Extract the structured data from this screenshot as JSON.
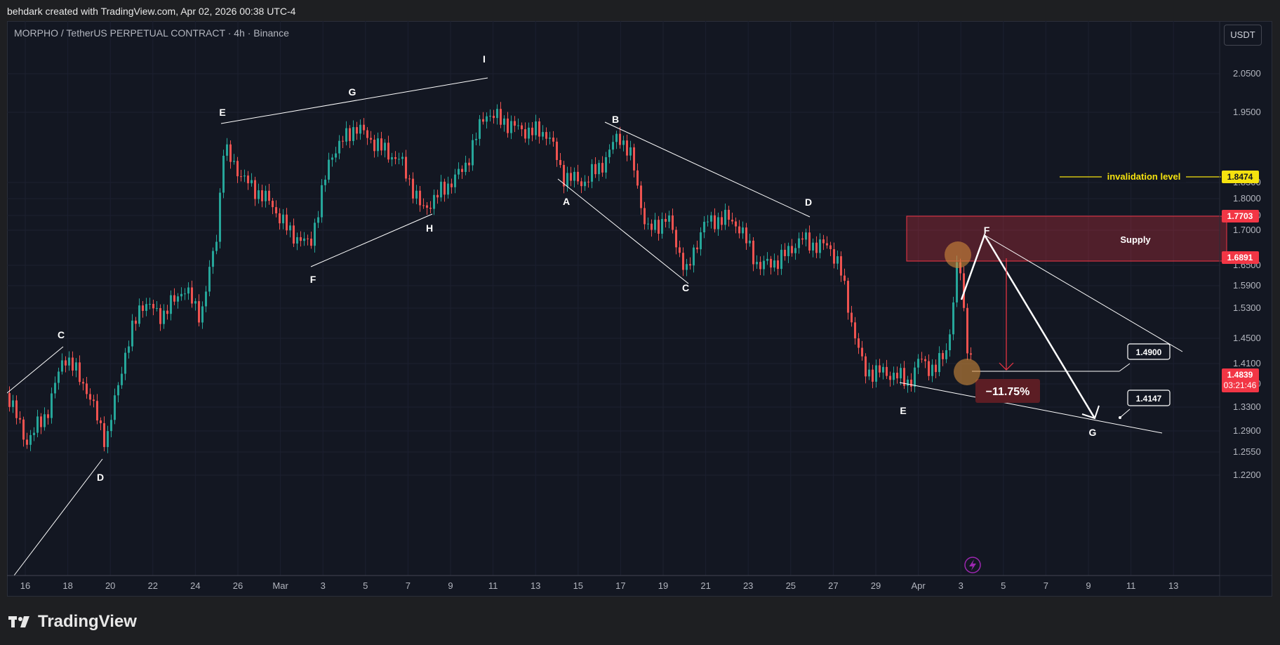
{
  "header": {
    "credit": "behdark created with TradingView.com, Apr 02, 2026 00:38 UTC-4"
  },
  "chart_header": {
    "symbol": "MORPHO / TetherUS PERPETUAL CONTRACT · 4h · Binance",
    "currency": "USDT"
  },
  "footer": {
    "brand": "TradingView"
  },
  "colors": {
    "background": "#131722",
    "up": "#26a69a",
    "down": "#ef5350",
    "supply_zone": "#f23645",
    "invalidation": "#f5e20f",
    "highlight": "#d08a3a"
  },
  "chart_data": {
    "type": "candlestick",
    "y_ticks": [
      "2.0500",
      "1.9500",
      "1.8500",
      "1.8000",
      "1.7500",
      "1.7000",
      "1.6500",
      "1.5900",
      "1.5300",
      "1.4500",
      "1.4100",
      "1.3700",
      "1.3300",
      "1.2900",
      "1.2550",
      "1.2200"
    ],
    "x_ticks": [
      "16",
      "18",
      "20",
      "22",
      "24",
      "26",
      "Mar",
      "3",
      "5",
      "7",
      "9",
      "11",
      "13",
      "15",
      "17",
      "19",
      "21",
      "23",
      "25",
      "27",
      "29",
      "Apr",
      "3",
      "5",
      "7",
      "9",
      "11",
      "13"
    ],
    "price_labels": [
      {
        "value": "1.8474",
        "color": "#f5e20f",
        "text_color": "#131722"
      },
      {
        "value": "1.7703",
        "color": "#f23645",
        "text_color": "#ffffff"
      },
      {
        "value": "1.6891",
        "color": "#f23645",
        "text_color": "#ffffff"
      },
      {
        "value": "1.4839",
        "color": "#f23645",
        "text_color": "#ffffff"
      }
    ],
    "countdown": "03:21:46",
    "invalidation_label": "invalidation level",
    "supply_label": "Supply",
    "percent_label": "−11.75%",
    "targets": [
      "1.4900",
      "1.4147"
    ],
    "wave_labels": [
      "C",
      "D",
      "E",
      "F",
      "G",
      "H",
      "I",
      "A",
      "B",
      "C",
      "D",
      "E",
      "F",
      "G"
    ]
  }
}
